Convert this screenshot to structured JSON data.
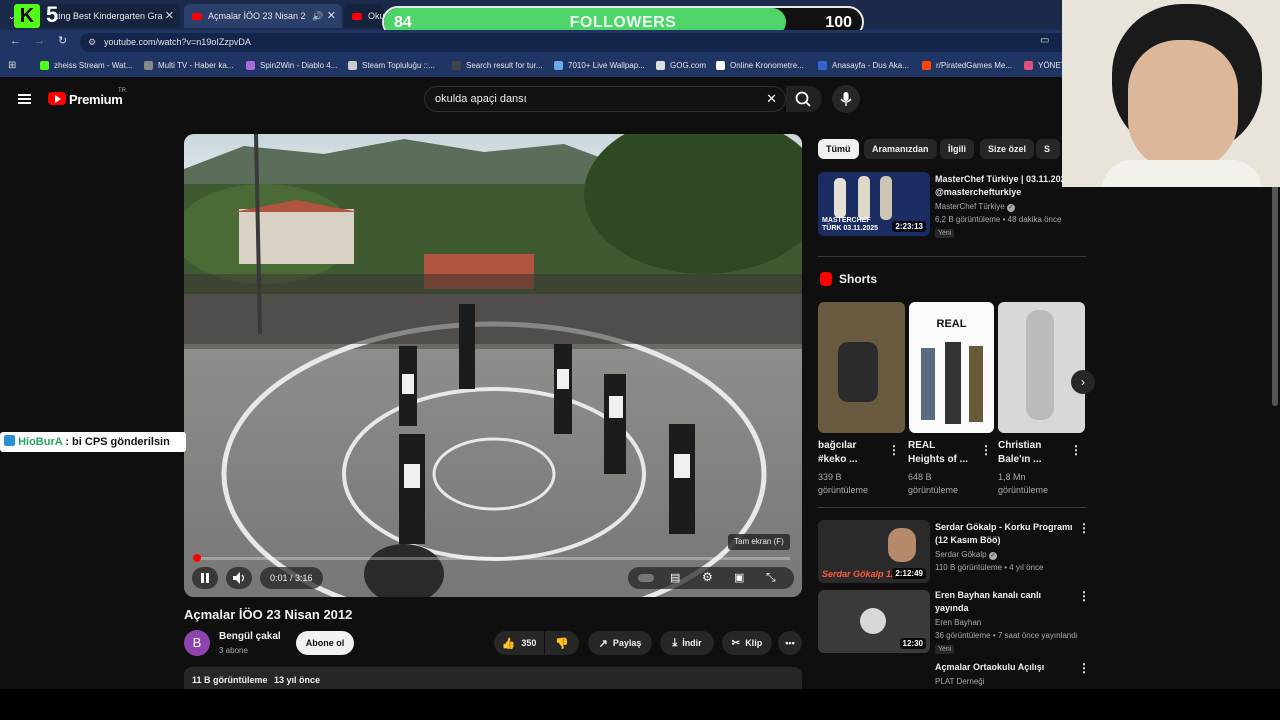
{
  "browser": {
    "tabs": [
      {
        "title": "king Best Kindergarten Gra"
      },
      {
        "title": "Açmalar İÖO 23 Nisan 2012"
      },
      {
        "title": "Okul"
      }
    ],
    "url": "youtube.com/watch?v=n19oIZzpvDA",
    "bookmarks": [
      {
        "label": "zheiss Stream - Wat...",
        "color": "#53fc18"
      },
      {
        "label": "Multi TV - Haber ka...",
        "color": "#888888"
      },
      {
        "label": "Spin2Win - Diablo 4...",
        "color": "#a86ad8"
      },
      {
        "label": "Steam Topluluğu ::...",
        "color": "#cccccc"
      },
      {
        "label": "Search result for tur...",
        "color": "#444444"
      },
      {
        "label": "7010+ Live Wallpap...",
        "color": "#6aa8e8"
      },
      {
        "label": "GOG.com",
        "color": "#dddddd"
      },
      {
        "label": "Online Kronometre...",
        "color": "#ffffff"
      },
      {
        "label": "Anasayfa - Dus Aka...",
        "color": "#3366cc"
      },
      {
        "label": "r/PiratedGames Me...",
        "color": "#ff4500"
      },
      {
        "label": "YÖNET",
        "color": "#e0507a"
      }
    ]
  },
  "stream_overlay": {
    "kick_number": "5",
    "kick_logo": "K",
    "followers_current": "84",
    "followers_label": "FOLLOWERS",
    "followers_goal": "100",
    "followers_progress": 0.84,
    "chat_user": "HioBurA",
    "chat_message": ": bi CPS gönderilsin"
  },
  "youtube": {
    "logo": "Premium",
    "region": "TR",
    "search_query": "okulda apaçi dansı"
  },
  "player": {
    "time": "0:01 / 3:16",
    "progress": 0.005,
    "tooltip": "Tam ekran (F)"
  },
  "video": {
    "title": "Açmalar İÖO 23 Nisan 2012",
    "channel": "Bengül çakal",
    "channel_initial": "B",
    "subscribers": "3 abone",
    "subscribe": "Abone ol",
    "likes": "350",
    "share": "Paylaş",
    "download": "İndir",
    "clip": "Klip",
    "views": "11 B görüntüleme",
    "age": "13 yıl önce"
  },
  "sidebar": {
    "chips": [
      "Tümü",
      "Aramanızdan",
      "İlgili",
      "Size özel",
      "S"
    ],
    "videos": [
      {
        "title": "MasterChef Türkiye | 03.11.2025 @masterchefturkiye",
        "channel": "MasterChef Türkiye",
        "meta": "6,2 B görüntüleme • 48 dakika önce",
        "badge": "Yeni",
        "duration": "2:23:13",
        "thumb_text": "MASTERCHEF TÜRK 03.11.2025"
      },
      {
        "title": "Serdar Gökalp - Korku Programı (12 Kasım Böö)",
        "channel": "Serdar Gökalp",
        "meta": "110 B görüntüleme • 4 yıl önce",
        "badge": "",
        "duration": "2:12:49",
        "thumb_text": "Serdar Gökalp 12"
      },
      {
        "title": "Eren Bayhan kanalı canlı yayında",
        "channel": "Eren Bayhan",
        "meta": "36 görüntüleme • 7 saat önce yayınlandı",
        "badge": "Yeni",
        "duration": "12:30",
        "thumb_text": ""
      },
      {
        "title": "Açmalar Ortaokulu Açılışı",
        "channel": "PLAT Derneği",
        "meta": "",
        "badge": "",
        "duration": "",
        "thumb_text": ""
      }
    ],
    "shorts_title": "Shorts",
    "shorts": [
      {
        "title": "bağcılar #keko ...",
        "views": "339 B görüntüleme"
      },
      {
        "title": "REAL Heights of ...",
        "views": "648 B görüntüleme",
        "overlay": "REAL"
      },
      {
        "title": "Christian Bale'ın ...",
        "views": "1,8 Mn görüntüleme"
      }
    ]
  }
}
